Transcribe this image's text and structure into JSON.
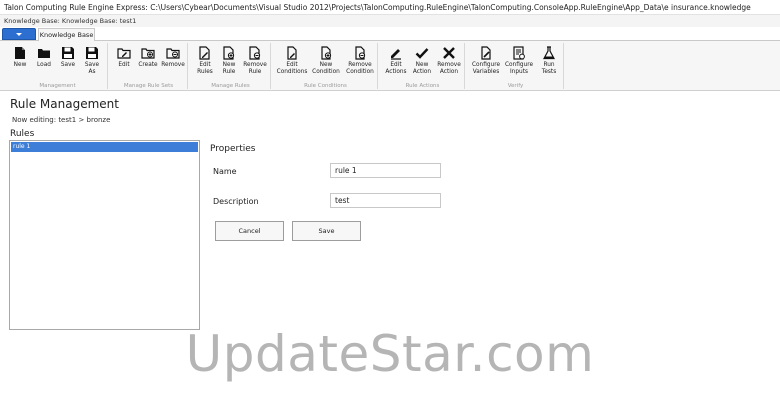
{
  "window": {
    "title": "Talon Computing Rule Engine Express: C:\\Users\\Cybear\\Documents\\Visual Studio 2012\\Projects\\TalonComputing.RuleEngine\\TalonComputing.ConsoleApp.RuleEngine\\App_Data\\e insurance.knowledge"
  },
  "kb_bar": {
    "text": "Knowledge Base: Knowledge Base: test1"
  },
  "tabs": {
    "knowledge_base": "Knowledge Base"
  },
  "ribbon": {
    "management": {
      "label": "Management",
      "new": "New",
      "load": "Load",
      "save": "Save",
      "save_as": "Save\nAs"
    },
    "manage_rule_sets": {
      "label": "Manage Rule Sets",
      "edit": "Edit",
      "create": "Create",
      "remove": "Remove"
    },
    "manage_rules": {
      "label": "Manage Rules",
      "edit_rules": "Edit\nRules",
      "new_rule": "New\nRule",
      "remove_rule": "Remove\nRule"
    },
    "rule_conditions": {
      "label": "Rule Conditions",
      "edit_conditions": "Edit\nConditions",
      "new_condition": "New\nCondition",
      "remove_condition": "Remove\nCondition"
    },
    "rule_actions": {
      "label": "Rule Actions",
      "edit_actions": "Edit\nActions",
      "new_action": "New\nAction",
      "remove_action": "Remove\nAction"
    },
    "verify": {
      "label": "Verify",
      "configure_variables": "Configure\nVariables",
      "configure_inputs": "Configure\nInputs",
      "run_tests": "Run\nTests"
    }
  },
  "main": {
    "heading": "Rule Management",
    "editing": "Now editing: test1 > bronze",
    "rules_label": "Rules",
    "rules": [
      "rule 1"
    ],
    "properties_title": "Properties",
    "name_label": "Name",
    "name_value": "rule 1",
    "description_label": "Description",
    "description_value": "test",
    "cancel": "Cancel",
    "save": "Save"
  },
  "watermark": "UpdateStar.com",
  "colors": {
    "selection": "#3d7ed9",
    "app_button": "#2d6fd1"
  }
}
